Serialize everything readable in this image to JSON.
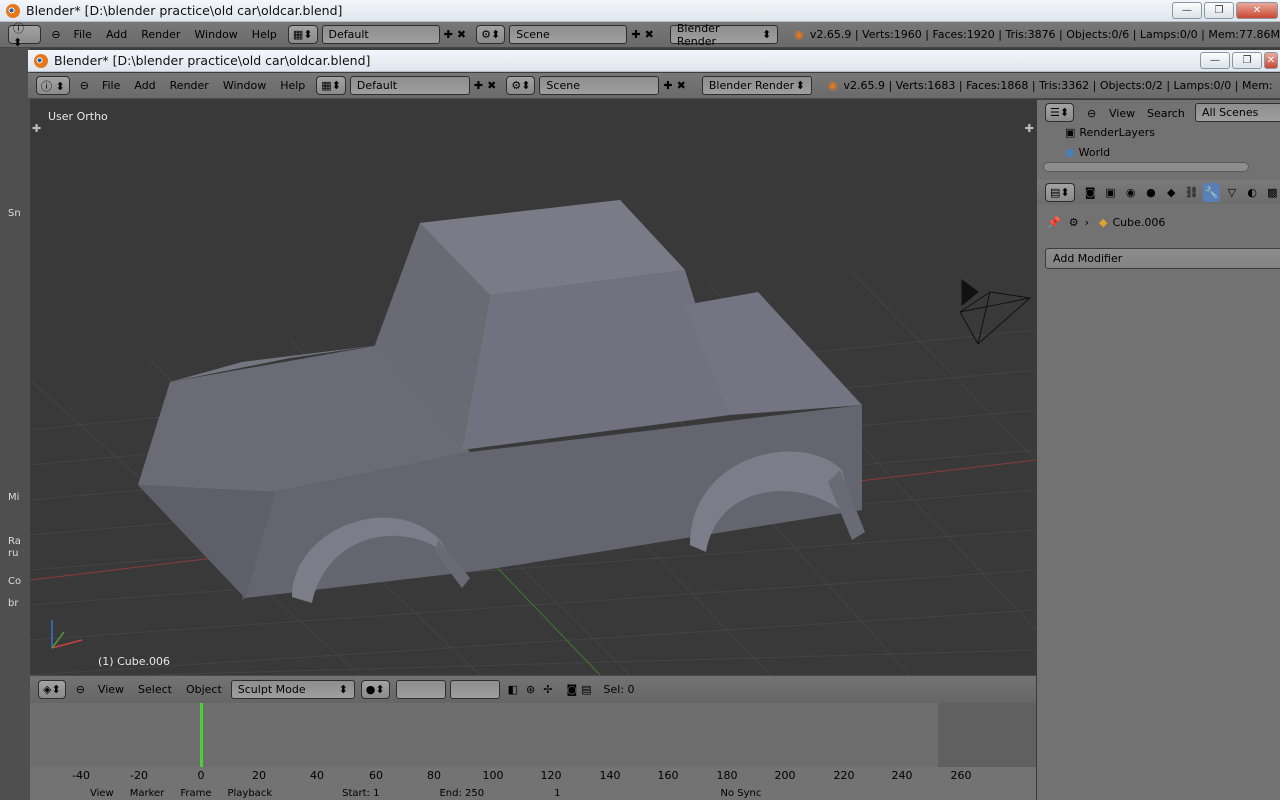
{
  "outer_window": {
    "title": "Blender* [D:\\blender practice\\old car\\oldcar.blend]",
    "header": {
      "menus": [
        "File",
        "Add",
        "Render",
        "Window",
        "Help"
      ],
      "layout": "Default",
      "scene": "Scene",
      "engine": "Blender Render",
      "stats": "v2.65.9 | Verts:1960 | Faces:1920 | Tris:3876 | Objects:0/6 | Lamps:0/0 | Mem:77.86M"
    }
  },
  "inner_window": {
    "title": "Blender* [D:\\blender practice\\old car\\oldcar.blend]",
    "header": {
      "menus": [
        "File",
        "Add",
        "Render",
        "Window",
        "Help"
      ],
      "layout": "Default",
      "scene": "Scene",
      "engine": "Blender Render",
      "stats": "v2.65.9 | Verts:1683 | Faces:1868 | Tris:3362 | Objects:0/2 | Lamps:0/0 | Mem:"
    }
  },
  "viewport": {
    "view_label": "User Ortho",
    "object_label": "(1) Cube.006"
  },
  "viewport_footer": {
    "menus": [
      "View",
      "Select",
      "Object"
    ],
    "mode": "Sculpt Mode",
    "sel": "Sel: 0"
  },
  "outliner": {
    "menus": [
      "View",
      "Search"
    ],
    "filter": "All Scenes",
    "items": [
      "RenderLayers",
      "World"
    ]
  },
  "properties": {
    "object_name": "Cube.006",
    "add_modifier": "Add Modifier"
  },
  "timeline": {
    "ticks": [
      "-40",
      "-20",
      "0",
      "20",
      "40",
      "60",
      "80",
      "100",
      "120",
      "140",
      "160",
      "180",
      "200",
      "220",
      "240",
      "260"
    ],
    "bottom": {
      "menus": [
        "View",
        "Marker",
        "Frame",
        "Playback"
      ],
      "start": "Start: 1",
      "end": "End: 250",
      "current": "1",
      "sync": "No Sync"
    }
  },
  "left_strip": {
    "labels": [
      "Sn",
      "Mi",
      "Ra",
      "ru",
      "Co",
      "br"
    ]
  }
}
